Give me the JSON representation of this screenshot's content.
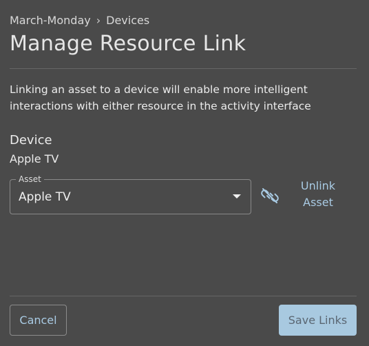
{
  "breadcrumb": {
    "parent": "March-Monday",
    "separator": "›",
    "current": "Devices"
  },
  "page_title": "Manage Resource Link",
  "description": "Linking an asset to a device will enable more intelligent interactions with either resource in the activity interface",
  "device": {
    "heading": "Device",
    "value": "Apple TV"
  },
  "asset": {
    "legend": "Asset",
    "selected": "Apple TV",
    "icon": "chevron-down-icon"
  },
  "unlink": {
    "icon": "unlink-icon",
    "label_line1": "Unlink",
    "label_line2": "Asset"
  },
  "footer": {
    "cancel_label": "Cancel",
    "save_label": "Save Links"
  },
  "colors": {
    "background": "#4a4a4a",
    "accent": "#a9cbe4",
    "primary_button": "#a8c9e0",
    "primary_button_text": "#5a6672"
  }
}
